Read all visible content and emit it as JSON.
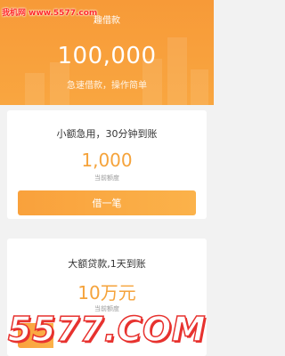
{
  "header": {
    "watermark": "我机网 www.5577.com",
    "title": "趣借款",
    "amount": "100,000",
    "tagline": "急速借款，操作简单"
  },
  "cards": [
    {
      "title": "小额急用，30分钟到账",
      "amount": "1,000",
      "subtitle": "当前额度",
      "button": "借一笔"
    },
    {
      "title": "大额贷款,1天到账",
      "amount": "10万元",
      "subtitle": "当前额度",
      "button": ""
    }
  ],
  "overlay": {
    "watermark": "5577.COM"
  },
  "colors": {
    "brand_orange": "#f79a38",
    "amount_orange": "#f5a33b",
    "watermark_red": "#e7322f"
  }
}
